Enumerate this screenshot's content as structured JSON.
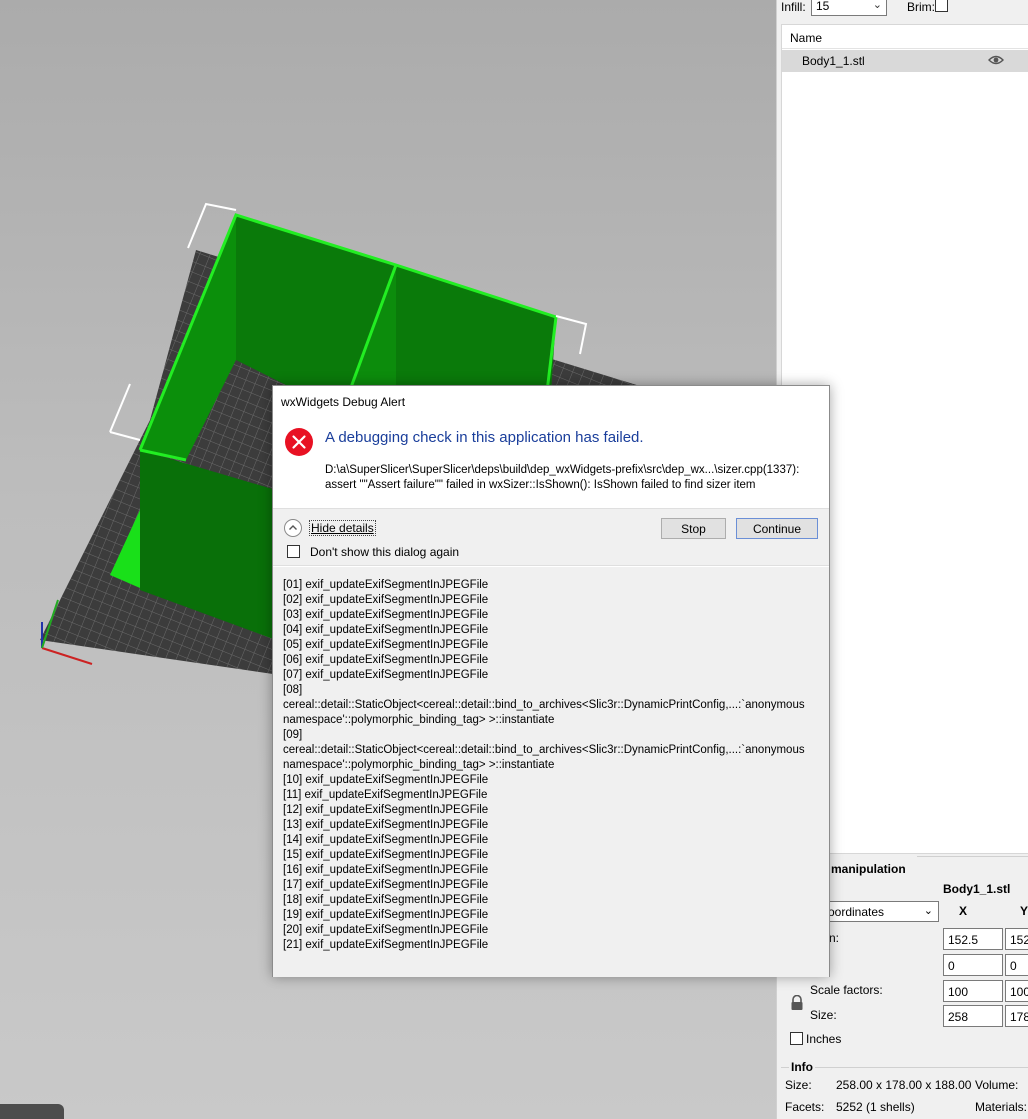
{
  "right_panel": {
    "infill_label": "Infill:",
    "infill_value": "15",
    "brim_label": "Brim:",
    "list_header": "Name",
    "object_name": "Body1_1.stl",
    "manipulation_title": "manipulation",
    "manipulation_object": "Body1_1.stl",
    "coord_system": "coordinates",
    "col_x": "X",
    "col_y": "Y",
    "position_label": "n:",
    "position_x": "152.5",
    "position_y": "152",
    "rotation_x": "0",
    "rotation_y": "0",
    "scale_label": "Scale factors:",
    "scale_x": "100",
    "scale_y": "100",
    "size_label": "Size:",
    "size_x": "258",
    "size_y": "178",
    "inches_label": "Inches",
    "info_title": "Info",
    "info_size_label": "Size:",
    "info_size_value": "258.00 x 178.00 x 188.00",
    "info_volume_label": "Volume:",
    "info_facets_label": "Facets:",
    "info_facets_value": "5252 (1 shells)",
    "info_materials_label": "Materials:"
  },
  "dialog": {
    "title": "wxWidgets Debug Alert",
    "main_instruction": "A debugging check in this application has failed.",
    "content_line1": "D:\\a\\SuperSlicer\\SuperSlicer\\deps\\build\\dep_wxWidgets-prefix\\src\\dep_wx...\\sizer.cpp(1337):",
    "content_line2": "assert \"\"Assert failure\"\" failed in wxSizer::IsShown(): IsShown failed to find sizer item",
    "hide_details": "Hide details",
    "dont_show": "Don't show this dialog again",
    "stop": "Stop",
    "continue": "Continue",
    "details": [
      "[01] exif_updateExifSegmentInJPEGFile",
      "[02] exif_updateExifSegmentInJPEGFile",
      "[03] exif_updateExifSegmentInJPEGFile",
      "[04] exif_updateExifSegmentInJPEGFile",
      "[05] exif_updateExifSegmentInJPEGFile",
      "[06] exif_updateExifSegmentInJPEGFile",
      "[07] exif_updateExifSegmentInJPEGFile",
      "[08]",
      "cereal::detail::StaticObject<cereal::detail::bind_to_archives<Slic3r::DynamicPrintConfig,...:`anonymous",
      "namespace'::polymorphic_binding_tag> >::instantiate",
      "[09]",
      "cereal::detail::StaticObject<cereal::detail::bind_to_archives<Slic3r::DynamicPrintConfig,...:`anonymous",
      "namespace'::polymorphic_binding_tag> >::instantiate",
      "[10] exif_updateExifSegmentInJPEGFile",
      "[11] exif_updateExifSegmentInJPEGFile",
      "[12] exif_updateExifSegmentInJPEGFile",
      "[13] exif_updateExifSegmentInJPEGFile",
      "[14] exif_updateExifSegmentInJPEGFile",
      "[15] exif_updateExifSegmentInJPEGFile",
      "[16] exif_updateExifSegmentInJPEGFile",
      "[17] exif_updateExifSegmentInJPEGFile",
      "[18] exif_updateExifSegmentInJPEGFile",
      "[19] exif_updateExifSegmentInJPEGFile",
      "[20] exif_updateExifSegmentInJPEGFile",
      "[21] exif_updateExifSegmentInJPEGFile"
    ]
  },
  "colors": {
    "accent_blue": "#1a3e9b",
    "error_red": "#e81123",
    "model_green": "#0a7a0a",
    "bed_dark": "#3a3a3a"
  }
}
